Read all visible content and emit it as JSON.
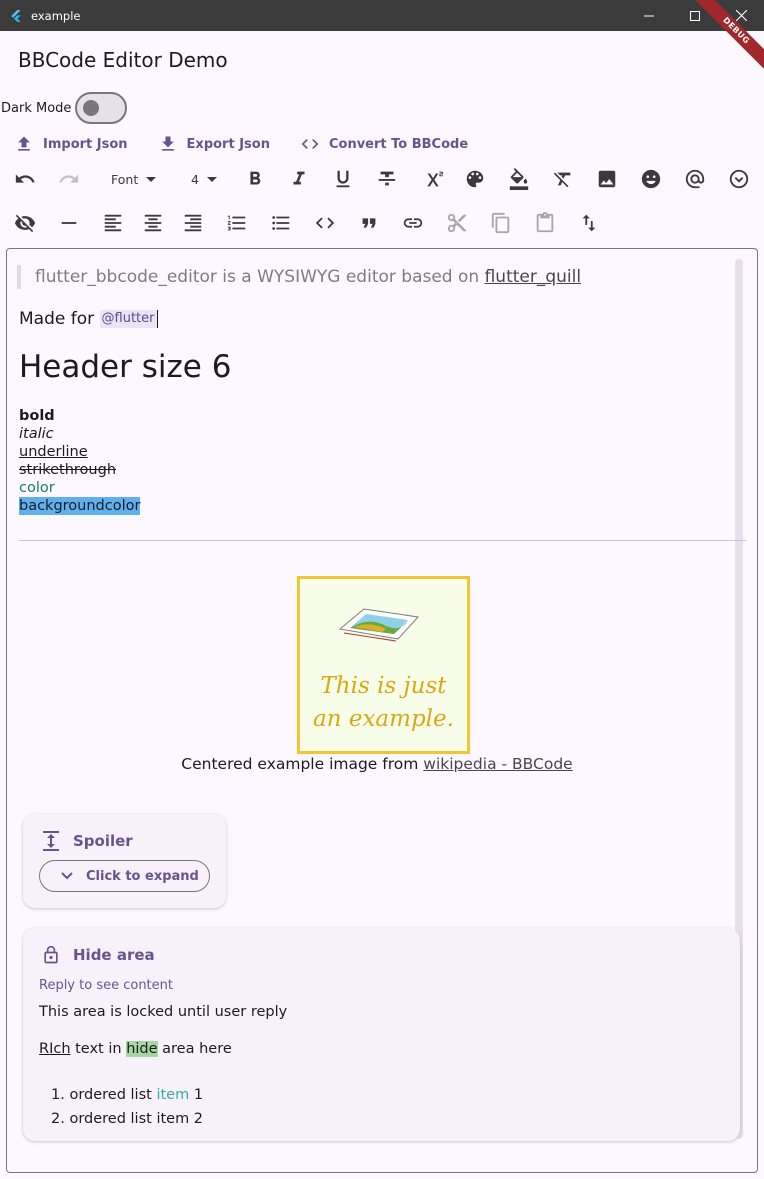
{
  "window": {
    "title": "example"
  },
  "debug_banner": "DEBUG",
  "app": {
    "title": "BBCode Editor Demo"
  },
  "dark_mode": {
    "label": "Dark Mode",
    "on": false
  },
  "actions": {
    "import": "Import Json",
    "export": "Export Json",
    "convert": "Convert To BBCode"
  },
  "toolbar": {
    "font_label": "Font",
    "size_label": "4"
  },
  "editor": {
    "quote_text": "flutter_bbcode_editor is a WYSIWYG editor based on ",
    "quote_link": "flutter_quill",
    "made_for_text": "Made for ",
    "mention": "@flutter",
    "header": "Header size 6",
    "styles": {
      "bold": "bold",
      "italic": "italic",
      "underline": "underline",
      "strike": "strikethrough",
      "color": "color",
      "background": "backgroundcolor"
    },
    "image_text_1": "This is just",
    "image_text_2": "an example.",
    "caption_text": "Centered example image from ",
    "caption_link": "wikipedia - BBCode",
    "spoiler": {
      "title": "Spoiler",
      "button": "Click to expand"
    },
    "hide_area": {
      "title": "Hide area",
      "subtitle": "Reply to see content",
      "locked_text": "This area is locked until user reply",
      "rich_part1": "RIch",
      "rich_part2": " text in ",
      "rich_part3": "hide",
      "rich_part4": " area here",
      "list": [
        {
          "number": "1.",
          "part1": "ordered list ",
          "part2": "item",
          "part3": " 1"
        },
        {
          "number": "2.",
          "part1": "ordered list item 2"
        }
      ]
    }
  },
  "colors": {
    "accent": "#65558f",
    "titlebar": "#3b3b3b",
    "background": "#fdf7ff",
    "highlight_blue": "#5fb0ef",
    "highlight_green": "#a7d7a0",
    "text_teal": "#15806b"
  }
}
